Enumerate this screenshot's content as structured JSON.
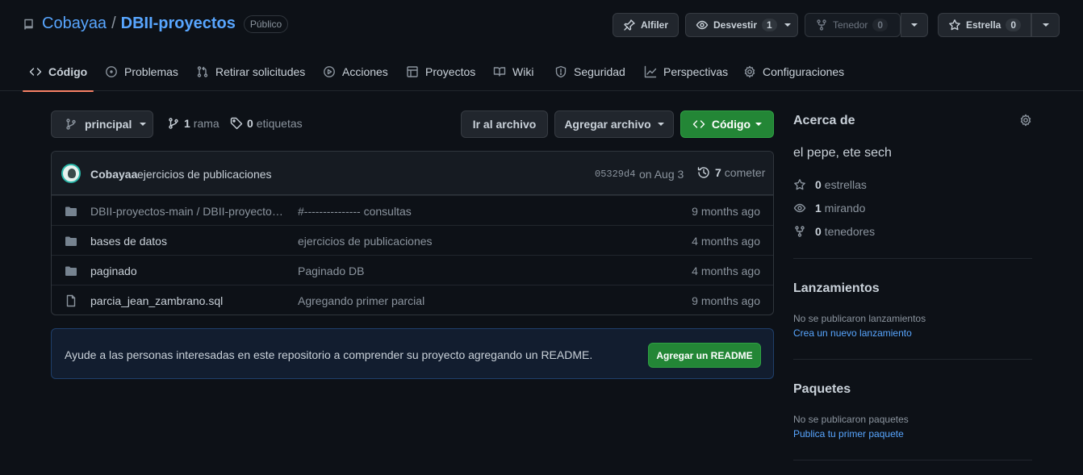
{
  "repo": {
    "owner": "Cobayaa",
    "separator": "/",
    "name": "DBII-proyectos",
    "visibility": "Público"
  },
  "header_actions": {
    "pin_label": "Alfiler",
    "watch_label": "Desvestir",
    "watch_count": "1",
    "fork_label": "Tenedor",
    "fork_count": "0",
    "star_label": "Estrella",
    "star_count": "0"
  },
  "tabs": [
    {
      "label": "Código",
      "icon": "code-icon",
      "active": true
    },
    {
      "label": "Problemas",
      "icon": "issue-icon"
    },
    {
      "label": "Retirar solicitudes",
      "icon": "pull-request-icon"
    },
    {
      "label": "Acciones",
      "icon": "play-icon"
    },
    {
      "label": "Proyectos",
      "icon": "table-icon"
    },
    {
      "label": "Wiki",
      "icon": "book-icon"
    },
    {
      "label": "Seguridad",
      "icon": "shield-icon"
    },
    {
      "label": "Perspectivas",
      "icon": "graph-icon"
    },
    {
      "label": "Configuraciones",
      "icon": "gear-icon"
    }
  ],
  "toolbar": {
    "branch": "principal",
    "branch_count": "1",
    "branch_word": "rama",
    "tag_count": "0",
    "tag_word": "etiquetas",
    "goto_file": "Ir al archivo",
    "add_file": "Agregar archivo",
    "code": "Código"
  },
  "latest_commit": {
    "author": "Cobayaa",
    "message": "ejercicios de publicaciones",
    "sha": "05329d4",
    "date": "on Aug 3",
    "count": "7",
    "count_word": "cometer"
  },
  "files": [
    {
      "type": "folder",
      "name": "DBII-proyectos-main / DBII-proyectos-main",
      "commit": "#--------------- consultas",
      "age": "9 months ago",
      "muted": true
    },
    {
      "type": "folder",
      "name": "bases de datos",
      "commit": "ejercicios de publicaciones",
      "age": "4 months ago"
    },
    {
      "type": "folder",
      "name": "paginado",
      "commit": "Paginado DB",
      "age": "4 months ago"
    },
    {
      "type": "file",
      "name": "parcia_jean_zambrano.sql",
      "commit": "Agregando primer parcial",
      "age": "9 months ago"
    }
  ],
  "readme": {
    "message": "Ayude a las personas interesadas en este repositorio a comprender su proyecto agregando un README.",
    "button": "Agregar un README"
  },
  "about": {
    "title": "Acerca de",
    "description": "el pepe, ete sech",
    "stars_count": "0",
    "stars_word": "estrellas",
    "watching_count": "1",
    "watching_word": "mirando",
    "forks_count": "0",
    "forks_word": "tenedores"
  },
  "releases": {
    "title": "Lanzamientos",
    "empty": "No se publicaron lanzamientos",
    "link": "Crea un nuevo lanzamiento"
  },
  "packages": {
    "title": "Paquetes",
    "empty": "No se publicaron paquetes",
    "link": "Publica tu primer paquete"
  },
  "colors": {
    "background": "#0d1117",
    "accent_link": "#58a6ff",
    "active_tab": "#f78166",
    "primary_button": "#238636"
  }
}
